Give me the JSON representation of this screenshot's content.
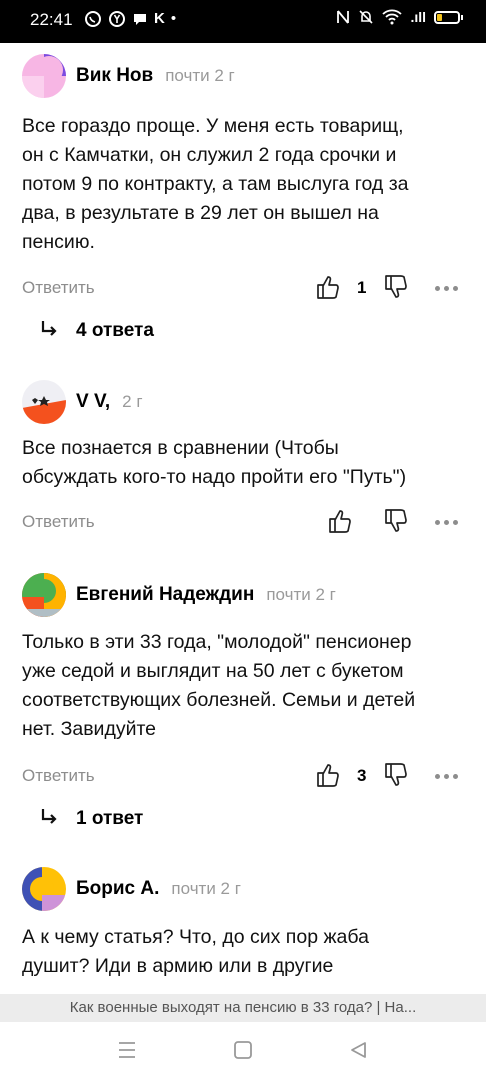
{
  "status_bar": {
    "time": "22:41",
    "k_label": "K",
    "dot": "•",
    "network": ".ıll"
  },
  "comments": [
    {
      "author": "Вик Нов",
      "time": "почти 2 г",
      "text_lines": [
        "Все гораздо проще. У меня есть товарищ,",
        "он с Камчатки, он служил 2 года срочки и",
        "потом 9 по контракту, а там выслуга год за",
        "два, в результате в 29 лет он вышел на",
        "пенсию."
      ],
      "reply_label": "Ответить",
      "likes": "1",
      "answers_label": "4 ответа"
    },
    {
      "author": "V V,",
      "time": "2 г",
      "text_lines": [
        "Все познается в сравнении (Чтобы",
        "обсуждать кого-то надо пройти его \"Путь\")"
      ],
      "reply_label": "Ответить",
      "likes": ""
    },
    {
      "author": "Евгений Надеждин",
      "time": "почти 2 г",
      "text_lines": [
        "Только в эти 33 года, \"молодой\" пенсионер",
        "уже седой и выглядит на 50 лет с букетом",
        "соответствующих болезней. Семьи и детей",
        "нет. Завидуйте"
      ],
      "reply_label": "Ответить",
      "likes": "3",
      "answers_label": "1 ответ"
    },
    {
      "author": "Борис А.",
      "time": "почти 2 г",
      "text_lines": [
        "А к чему статья? Что, до сих пор жаба",
        "душит? Иди в армию или в другие"
      ]
    }
  ],
  "url_bar": {
    "title": "Как военные выходят на пенсию в 33 года? | На..."
  },
  "colors": {
    "status_bg": "#000000",
    "muted": "#8d8d8d",
    "url_bg": "#ececec"
  }
}
